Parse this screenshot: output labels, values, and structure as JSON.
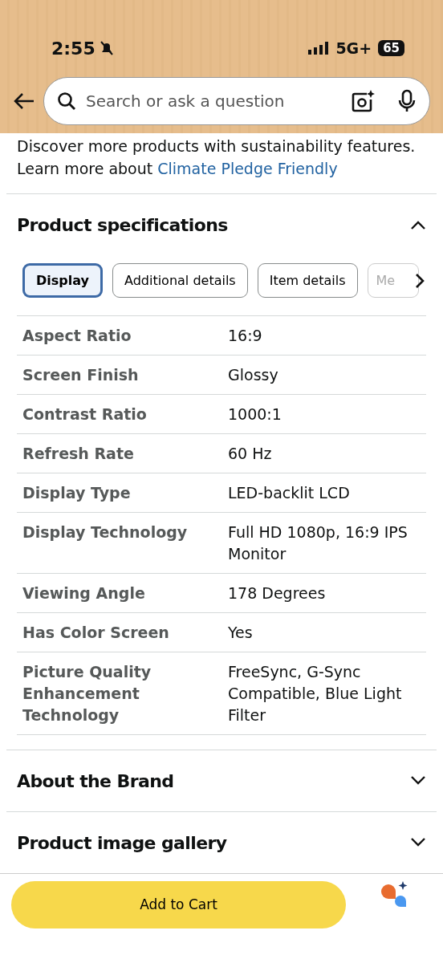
{
  "status_bar": {
    "time": "2:55",
    "network": "5G+",
    "battery": "65"
  },
  "search": {
    "placeholder": "Search or ask a question"
  },
  "sustainability": {
    "text": "Discover more products with sustainability features.",
    "prefix": "Learn more about",
    "link": "Climate Pledge Friendly"
  },
  "sections": [
    {
      "title": "Product specifications",
      "expanded": true,
      "tabs": [
        {
          "label": "Display",
          "selected": true
        },
        {
          "label": "Additional details",
          "selected": false
        },
        {
          "label": "Item details",
          "selected": false
        },
        {
          "label": "Me",
          "selected": false
        }
      ],
      "specs": [
        {
          "name": "Aspect Ratio",
          "value": "16:9"
        },
        {
          "name": "Screen Finish",
          "value": "Glossy"
        },
        {
          "name": "Contrast Ratio",
          "value": "1000:1"
        },
        {
          "name": "Refresh Rate",
          "value": "60 Hz"
        },
        {
          "name": "Display Type",
          "value": "LED-backlit LCD"
        },
        {
          "name": "Display Technology",
          "value": "Full HD 1080p, 16:9 IPS Monitor"
        },
        {
          "name": "Viewing Angle",
          "value": "178 Degrees"
        },
        {
          "name": "Has Color Screen",
          "value": "Yes"
        },
        {
          "name": "Picture Quality Enhancement Technology",
          "value": "FreeSync, G-Sync Compatible, Blue Light Filter"
        }
      ]
    },
    {
      "title": "About the Brand",
      "expanded": false
    },
    {
      "title": "Product image gallery",
      "expanded": false
    }
  ],
  "add_to_cart": "Add to Cart"
}
